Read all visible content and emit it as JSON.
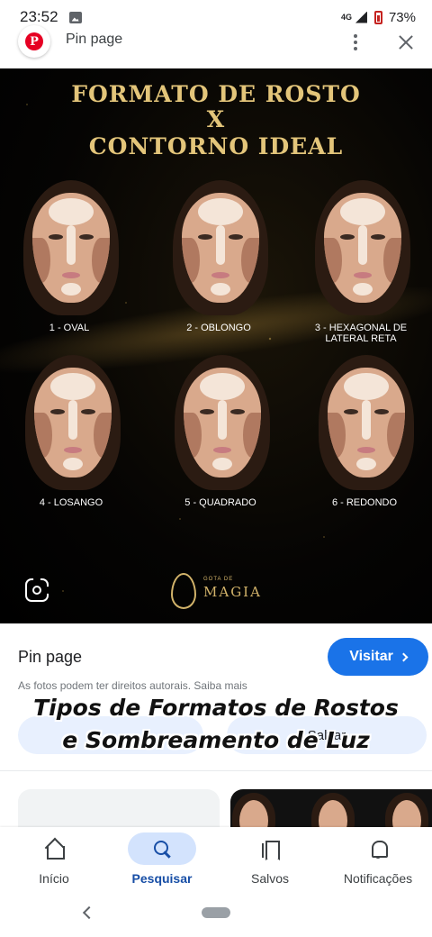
{
  "status_bar": {
    "time": "23:52",
    "network": "4G",
    "battery": "73%"
  },
  "topbar": {
    "title": "Pin page",
    "logo_letter": "P"
  },
  "image": {
    "title_line1": "FORMATO DE ROSTO",
    "title_x": "X",
    "title_line2": "CONTORNO IDEAL",
    "faces": [
      {
        "label": "1 - OVAL"
      },
      {
        "label": "2 - OBLONGO"
      },
      {
        "label": "3 - HEXAGONAL DE LATERAL RETA"
      },
      {
        "label": "4 - LOSANGO"
      },
      {
        "label": "5 - QUADRADO"
      },
      {
        "label": "6 - REDONDO"
      }
    ],
    "logo_small": "GOTA DE",
    "logo_text": "MAGIA"
  },
  "result": {
    "source": "Pin page",
    "visit_label": "Visitar",
    "rights_text": "As fotos podem ter direitos autorais. Saiba mais",
    "save_label": "Salvar",
    "caption_line1": "Tipos de Formatos de Rostos",
    "caption_line2": "e Sombreamento de Luz"
  },
  "bottom_nav": {
    "items": [
      {
        "label": "Início",
        "icon": "home-icon"
      },
      {
        "label": "Pesquisar",
        "icon": "search-icon"
      },
      {
        "label": "Salvos",
        "icon": "bookmarks-icon"
      },
      {
        "label": "Notificações",
        "icon": "bell-icon"
      }
    ],
    "active_index": 1
  },
  "colors": {
    "accent": "#1a73e8",
    "gold": "#e3c57a",
    "active_nav_bg": "#d3e3fd"
  }
}
